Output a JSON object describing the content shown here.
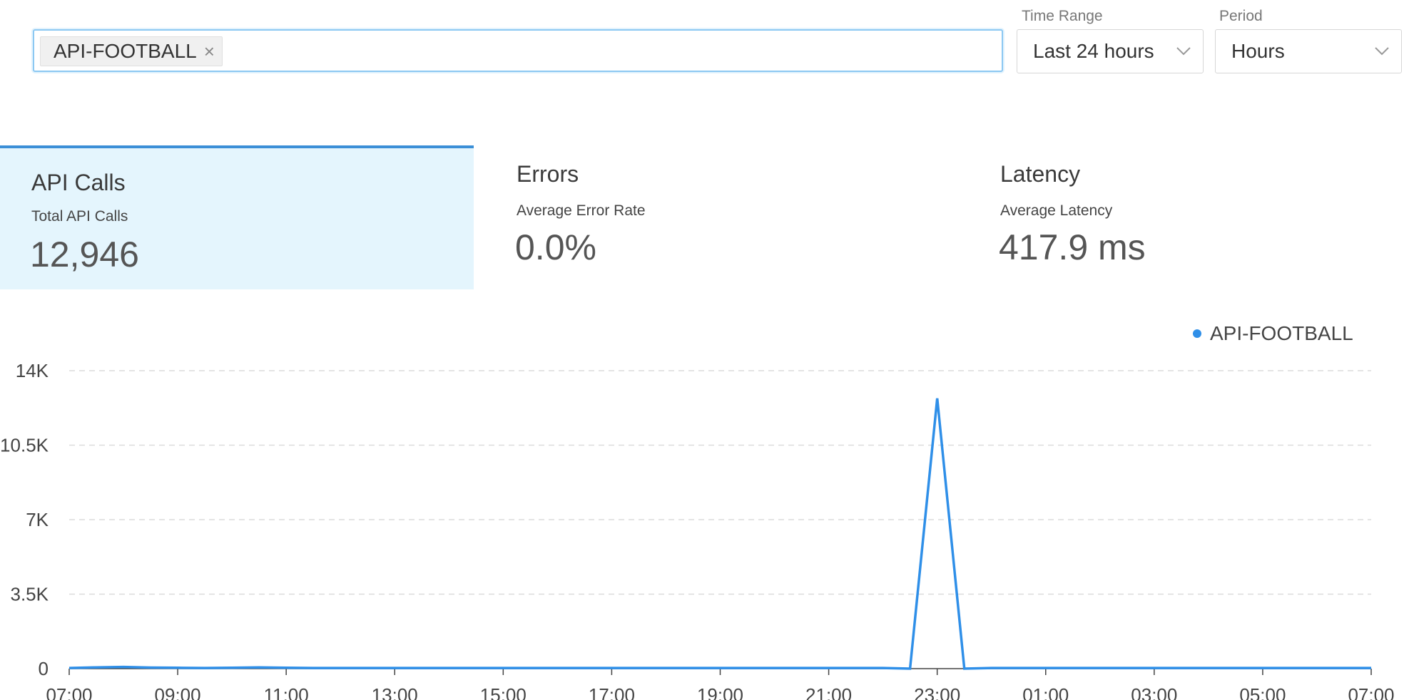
{
  "filter": {
    "chip_label": "API-FOOTBALL",
    "chip_remove": "×"
  },
  "time_range": {
    "label": "Time Range",
    "value": "Last 24 hours"
  },
  "period": {
    "label": "Period",
    "value": "Hours"
  },
  "metrics": [
    {
      "title": "API Calls",
      "subtitle": "Total API Calls",
      "value": "12,946",
      "active": true
    },
    {
      "title": "Errors",
      "subtitle": "Average Error Rate",
      "value": "0.0%",
      "active": false
    },
    {
      "title": "Latency",
      "subtitle": "Average Latency",
      "value": "417.9 ms",
      "active": false
    }
  ],
  "colors": {
    "accent": "#2f8fe8",
    "active_tab_bg": "#e4f5fd",
    "active_tab_border": "#3b8fd7"
  },
  "chart_data": {
    "type": "line",
    "x_tick_labels": [
      "07:00",
      "09:00",
      "11:00",
      "13:00",
      "15:00",
      "17:00",
      "19:00",
      "21:00",
      "23:00",
      "01:00",
      "03:00",
      "05:00",
      "07:00"
    ],
    "y_tick_labels": [
      "0",
      "3.5K",
      "7K",
      "10.5K",
      "14K"
    ],
    "ylim": [
      0,
      14000
    ],
    "grid": true,
    "legend_position": "top-right",
    "series": [
      {
        "name": "API-FOOTBALL",
        "color": "#2f8fe8",
        "values": [
          30,
          60,
          80,
          50,
          40,
          30,
          40,
          60,
          40,
          30,
          30,
          30,
          30,
          30,
          30,
          30,
          30,
          30,
          30,
          30,
          30,
          30,
          30,
          30,
          30,
          30,
          30,
          30,
          30,
          30,
          30,
          0,
          12700,
          0,
          30,
          30,
          30,
          30,
          30,
          30,
          30,
          30,
          30,
          30,
          30,
          30,
          30,
          30,
          30
        ]
      }
    ]
  }
}
